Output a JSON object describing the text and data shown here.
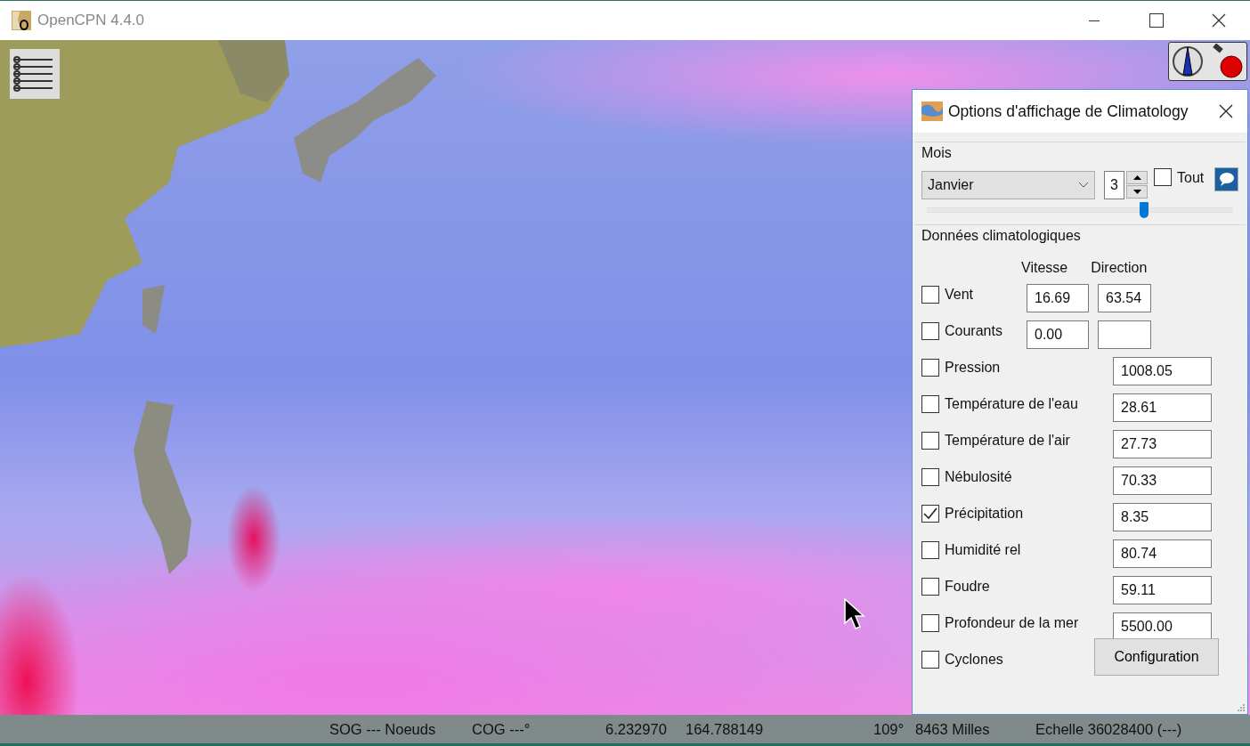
{
  "window": {
    "title": "OpenCPN 4.4.0"
  },
  "dialog": {
    "title": "Options d'affichage de Climatology",
    "month_section": {
      "label": "Mois",
      "month": "Janvier",
      "spin_value": "3",
      "all_label": "Tout",
      "all_checked": false,
      "level": 0.71
    },
    "data_section": {
      "label": "Données climatologiques",
      "column_headers": [
        "Vitesse",
        "Direction"
      ],
      "rows": [
        {
          "kind": "vector",
          "label": "Vent",
          "checked": false,
          "speed": "16.69",
          "direction": "63.54"
        },
        {
          "kind": "vector",
          "label": "Courants",
          "checked": false,
          "speed": "0.00"
        },
        {
          "kind": "scalar",
          "label": "Pression",
          "checked": false,
          "value": "1008.05"
        },
        {
          "kind": "scalar",
          "label": "Température de l'eau",
          "checked": false,
          "value": "28.61"
        },
        {
          "kind": "scalar",
          "label": "Température de l'air",
          "checked": false,
          "value": "27.73"
        },
        {
          "kind": "scalar",
          "label": "Nébulosité",
          "checked": false,
          "value": "70.33"
        },
        {
          "kind": "scalar",
          "label": "Précipitation",
          "checked": true,
          "value": "8.35"
        },
        {
          "kind": "scalar",
          "label": "Humidité rel",
          "checked": false,
          "value": "80.74"
        },
        {
          "kind": "scalar",
          "label": "Foudre",
          "checked": false,
          "value": "59.11"
        },
        {
          "kind": "scalar",
          "label": "Profondeur de la mer",
          "checked": false,
          "value": "5500.00"
        },
        {
          "kind": "button",
          "label": "Cyclones",
          "checked": false,
          "button": "Configuration"
        }
      ]
    }
  },
  "status_bar": [
    "SOG --- Noeuds",
    "COG ---°",
    "6.232970",
    "164.788149",
    "109°",
    "8463 Milles",
    "Echelle 36028400 (---)"
  ]
}
